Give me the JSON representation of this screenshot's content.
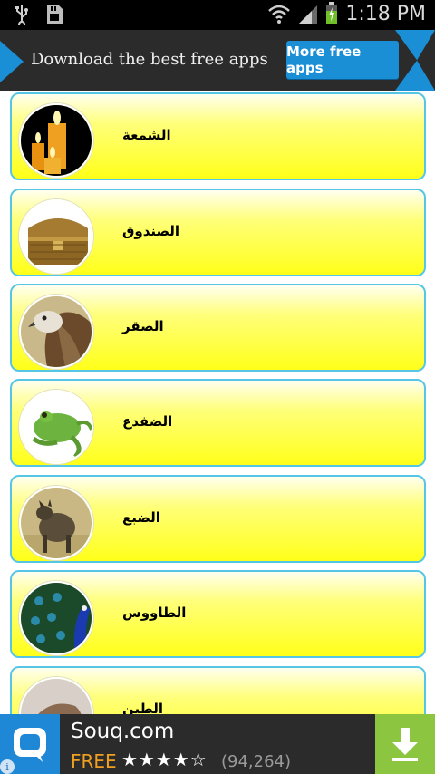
{
  "status_bar": {
    "time": "1:18 PM",
    "left_icons": [
      "usb-icon",
      "sd-card-icon"
    ],
    "right_icons": [
      "wifi-icon",
      "signal-icon",
      "battery-icon"
    ]
  },
  "top_banner": {
    "text": "Download the best free apps",
    "button_label": "More free apps",
    "accent_color": "#1a8fd6"
  },
  "list": {
    "items": [
      {
        "label": "الشمعة",
        "thumb_icon": "candle-icon"
      },
      {
        "label": "الصندوق",
        "thumb_icon": "treasure-chest-icon"
      },
      {
        "label": "الصقر",
        "thumb_icon": "falcon-icon"
      },
      {
        "label": "الضفدع",
        "thumb_icon": "frog-icon"
      },
      {
        "label": "الضبع",
        "thumb_icon": "hyena-icon"
      },
      {
        "label": "الطاووس",
        "thumb_icon": "peacock-icon"
      },
      {
        "label": "الطين",
        "thumb_icon": "clay-icon"
      }
    ]
  },
  "bottom_ad": {
    "app_name": "Souq.com",
    "price": "FREE",
    "rating": 4,
    "rating_max": 5,
    "stars_text": "★★★★☆",
    "review_count": "(94,264)",
    "info_glyph": "i",
    "download_color": "#8cc540"
  }
}
